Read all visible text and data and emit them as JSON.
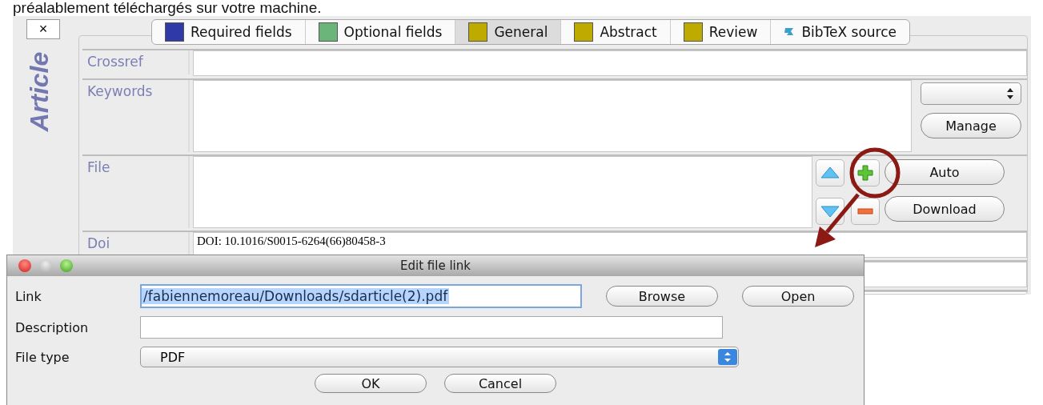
{
  "caption": "préalablement téléchargés sur votre machine.",
  "close_button": "×",
  "entry_type": "Article",
  "tabs": [
    {
      "label": "Required fields",
      "kind": "swatch",
      "color": "#3039a8",
      "selected": false
    },
    {
      "label": "Optional fields",
      "kind": "swatch",
      "color": "#6cb57a",
      "selected": false
    },
    {
      "label": "General",
      "kind": "swatch",
      "color": "#bfaa00",
      "selected": true
    },
    {
      "label": "Abstract",
      "kind": "swatch",
      "color": "#bfaa00",
      "selected": false
    },
    {
      "label": "Review",
      "kind": "swatch",
      "color": "#bfaa00",
      "selected": false
    },
    {
      "label": "BibTeX source",
      "kind": "source",
      "selected": false
    }
  ],
  "fields": [
    {
      "label": "Crossref",
      "kind": "line"
    },
    {
      "label": "Keywords",
      "kind": "keywords"
    },
    {
      "label": "File",
      "kind": "file"
    },
    {
      "label": "Doi",
      "kind": "line",
      "value": "DOI: 10.1016/S0015-6264(66)80458-3"
    },
    {
      "kind": "line"
    },
    {
      "kind": "line"
    }
  ],
  "keywords_side": {
    "manage_button": "Manage"
  },
  "file_side": {
    "auto_button": "Auto",
    "download_button": "Download"
  },
  "dialog": {
    "title": "Edit file link",
    "link_label": "Link",
    "link_value": "/fabiennemoreau/Downloads/sdarticle(2).pdf",
    "browse_button": "Browse",
    "open_button": "Open",
    "description_label": "Description",
    "file_type_label": "File type",
    "file_type_value": "PDF",
    "ok_button": "OK",
    "cancel_button": "Cancel"
  }
}
